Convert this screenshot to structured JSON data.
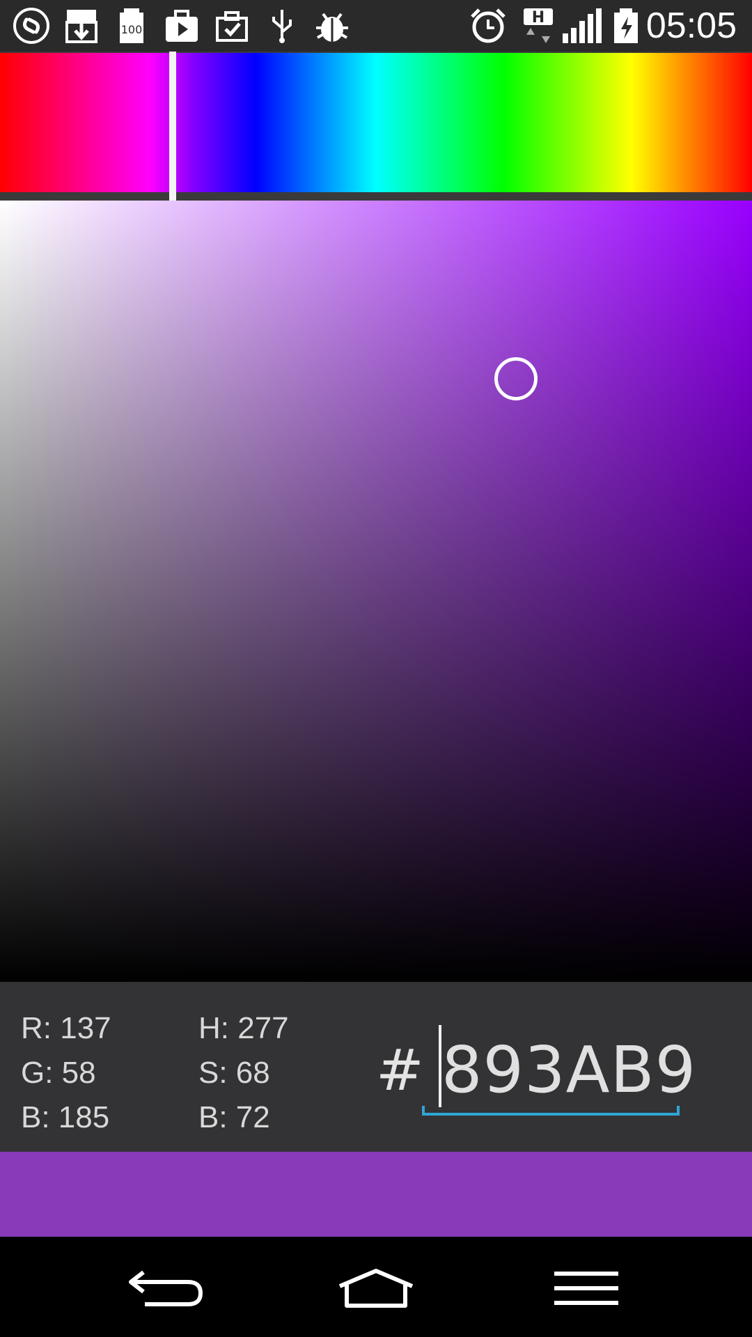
{
  "status_bar": {
    "time": "05:05",
    "icons": [
      "shazam-icon",
      "download-icon",
      "battery-100-icon",
      "play-store-icon",
      "briefcase-check-icon",
      "usb-icon",
      "bug-icon",
      "alarm-icon",
      "network-h-icon",
      "signal-icon",
      "battery-charging-icon"
    ],
    "network_label": "H",
    "battery_label": "100"
  },
  "hue_bar": {
    "selected_hue_fraction": 0.23
  },
  "sv_panel": {
    "base_color": "#9900ff",
    "cursor_saturation_fraction": 0.686,
    "cursor_brightness_fraction": 0.772
  },
  "values": {
    "r": "R: 137",
    "g": "G: 58",
    "b": "B: 185",
    "h": "H: 277",
    "s": "S: 68",
    "v": "B: 72"
  },
  "hex": {
    "prefix": "#",
    "value": "893AB9"
  },
  "preview": {
    "color": "#893AB9"
  },
  "colors": {
    "accent_underline": "#2fa5d6",
    "panel_bg": "#333335"
  }
}
